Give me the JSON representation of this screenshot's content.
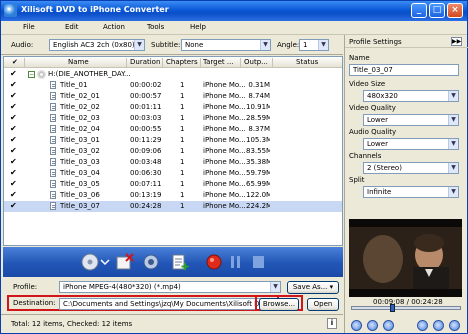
{
  "window": {
    "title": "Xilisoft DVD to iPhone Converter"
  },
  "titlebar_buttons": {
    "minimize": "_",
    "maximize": "□",
    "close": "×"
  },
  "menu": [
    "File",
    "Edit",
    "Action",
    "Tools",
    "Help"
  ],
  "options": {
    "audio_label": "Audio:",
    "audio_value": "English AC3 2ch (0x80)",
    "subtitle_label": "Subtitle:",
    "subtitle_value": "None",
    "angle_label": "Angle:",
    "angle_value": "1"
  },
  "table": {
    "columns": [
      "Name",
      "Duration",
      "Chapters",
      "Target ...",
      "Outp...",
      "Status"
    ],
    "root": {
      "label": "H:(DIE_ANOTHER_DAY...",
      "checked": true
    },
    "rows": [
      {
        "name": "Title_01",
        "duration": "00:00:02",
        "chapters": "1",
        "target": "iPhone Mo...",
        "output": "0.31M",
        "status": "",
        "checked": true
      },
      {
        "name": "Title_02_01",
        "duration": "00:00:57",
        "chapters": "1",
        "target": "iPhone Mo...",
        "output": "8.74M",
        "status": "",
        "checked": true
      },
      {
        "name": "Title_02_02",
        "duration": "00:01:11",
        "chapters": "1",
        "target": "iPhone Mo...",
        "output": "10.91M",
        "status": "",
        "checked": true
      },
      {
        "name": "Title_02_03",
        "duration": "00:03:03",
        "chapters": "1",
        "target": "iPhone Mo...",
        "output": "28.59M",
        "status": "",
        "checked": true
      },
      {
        "name": "Title_02_04",
        "duration": "00:00:55",
        "chapters": "1",
        "target": "iPhone Mo...",
        "output": "8.37M",
        "status": "",
        "checked": true
      },
      {
        "name": "Title_03_01",
        "duration": "00:11:29",
        "chapters": "1",
        "target": "iPhone Mo...",
        "output": "105.3M",
        "status": "",
        "checked": true
      },
      {
        "name": "Title_03_02",
        "duration": "00:09:06",
        "chapters": "1",
        "target": "iPhone Mo...",
        "output": "83.55M",
        "status": "",
        "checked": true
      },
      {
        "name": "Title_03_03",
        "duration": "00:03:48",
        "chapters": "1",
        "target": "iPhone Mo...",
        "output": "35.38M",
        "status": "",
        "checked": true
      },
      {
        "name": "Title_03_04",
        "duration": "00:06:30",
        "chapters": "1",
        "target": "iPhone Mo...",
        "output": "59.79M",
        "status": "",
        "checked": true
      },
      {
        "name": "Title_03_05",
        "duration": "00:07:11",
        "chapters": "1",
        "target": "iPhone Mo...",
        "output": "65.99M",
        "status": "",
        "checked": true
      },
      {
        "name": "Title_03_06",
        "duration": "00:13:19",
        "chapters": "1",
        "target": "iPhone Mo...",
        "output": "122.0M",
        "status": "",
        "checked": true
      },
      {
        "name": "Title_03_07",
        "duration": "00:24:28",
        "chapters": "1",
        "target": "iPhone Mo...",
        "output": "224.2M",
        "status": "",
        "checked": true
      }
    ]
  },
  "toolbar": {
    "icons": [
      "add-dvd-icon",
      "remove-icon",
      "snapshot-icon",
      "add-profile-icon",
      "convert-icon",
      "pause-icon",
      "stop-icon"
    ]
  },
  "form": {
    "profile_label": "Profile:",
    "profile_value": "iPhone MPEG-4(480*320)  (*.mp4)",
    "save_as_label": "Save As...",
    "destination_label": "Destination:",
    "destination_value": "C:\\Documents and Settings\\jzq\\My Documents\\Xilisoft DVD to",
    "browse_label": "Browse...",
    "open_label": "Open"
  },
  "status": {
    "text": "Total: 12 items, Checked: 12 items",
    "info": "i"
  },
  "panel": {
    "title": "Profile Settings",
    "name_label": "Name",
    "name_value": "Title_03_07",
    "video_size_label": "Video Size",
    "video_size_value": "480x320",
    "video_quality_label": "Video Quality",
    "video_quality_value": "Lower",
    "audio_quality_label": "Audio Quality",
    "audio_quality_value": "Lower",
    "channels_label": "Channels",
    "channels_value": "2 (Stereo)",
    "split_label": "Split",
    "split_value": "Infinite",
    "time_text": "00:09:08 / 00:24:28",
    "seek_position": 0.37
  },
  "colors": {
    "title_bar": "#0b58d6",
    "toolbar": "#2256b6",
    "highlight": "#d0161b",
    "selection": "#c8d8f4"
  }
}
